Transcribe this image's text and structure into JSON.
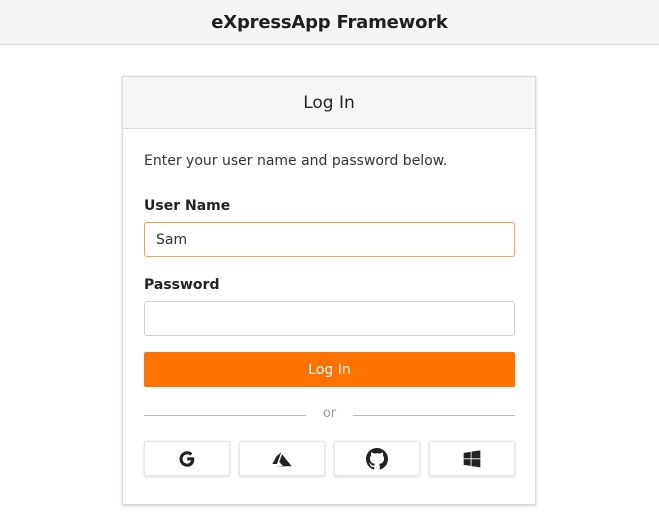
{
  "app": {
    "title": "eXpressApp Framework"
  },
  "login": {
    "title": "Log In",
    "instructions": "Enter your user name and password below.",
    "username": {
      "label": "User Name",
      "value": "Sam"
    },
    "password": {
      "label": "Password",
      "value": ""
    },
    "submit_label": "Log In",
    "divider_text": "or",
    "providers": [
      {
        "name": "Google",
        "icon": "google-icon"
      },
      {
        "name": "Azure",
        "icon": "azure-icon"
      },
      {
        "name": "GitHub",
        "icon": "github-icon"
      },
      {
        "name": "Microsoft",
        "icon": "windows-icon"
      }
    ]
  },
  "colors": {
    "accent": "#ff7200",
    "focus_border": "#f0a35a",
    "header_bg": "#f5f5f5"
  }
}
